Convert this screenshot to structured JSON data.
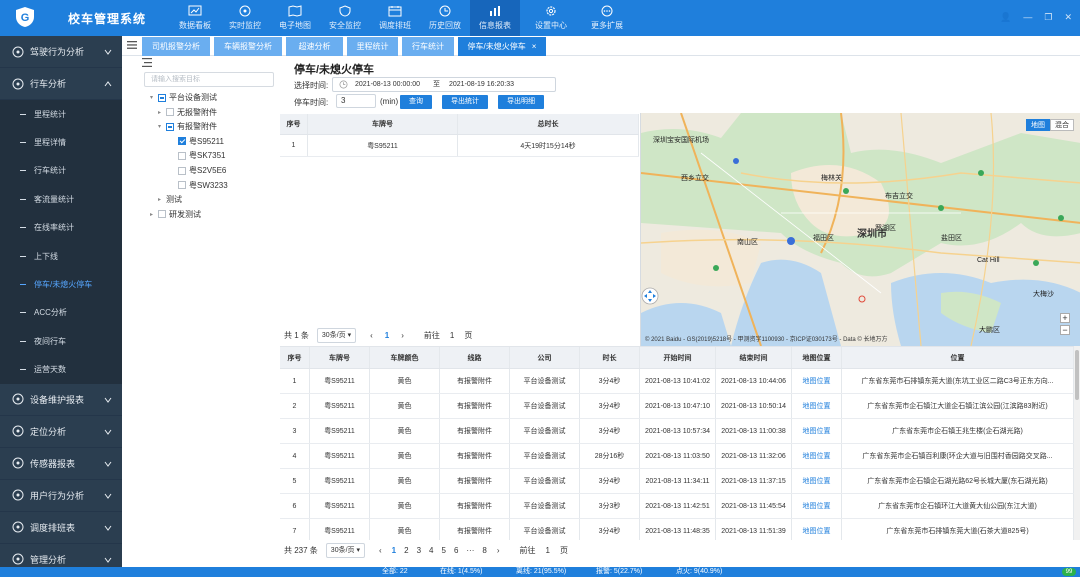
{
  "app": {
    "title": "校车管理系统"
  },
  "topnav": [
    {
      "label": "数据看板",
      "icon": "chart-board-icon"
    },
    {
      "label": "实时监控",
      "icon": "monitor-icon"
    },
    {
      "label": "电子地图",
      "icon": "map-icon"
    },
    {
      "label": "安全监控",
      "icon": "shield-icon"
    },
    {
      "label": "调度排班",
      "icon": "schedule-icon"
    },
    {
      "label": "历史回放",
      "icon": "history-icon"
    },
    {
      "label": "信息报表",
      "icon": "bar-chart-icon",
      "active": true
    },
    {
      "label": "设置中心",
      "icon": "gear-icon"
    },
    {
      "label": "更多扩展",
      "icon": "more-icon"
    }
  ],
  "sidebar": {
    "groups_top": [
      {
        "label": "驾驶行为分析"
      },
      {
        "label": "行车分析"
      }
    ],
    "subitems": [
      {
        "label": "里程统计"
      },
      {
        "label": "里程详情"
      },
      {
        "label": "行车统计"
      },
      {
        "label": "客流量统计"
      },
      {
        "label": "在线率统计"
      },
      {
        "label": "上下线"
      },
      {
        "label": "停车/未熄火停车",
        "active": true
      },
      {
        "label": "ACC分析"
      },
      {
        "label": "夜间行车"
      },
      {
        "label": "运营天数"
      }
    ],
    "groups_bottom": [
      {
        "label": "设备维护报表"
      },
      {
        "label": "定位分析"
      },
      {
        "label": "传感器报表"
      },
      {
        "label": "用户行为分析"
      },
      {
        "label": "调度排班表"
      },
      {
        "label": "管理分析"
      }
    ]
  },
  "tabs": [
    {
      "label": "司机报警分析"
    },
    {
      "label": "车辆报警分析"
    },
    {
      "label": "超速分析"
    },
    {
      "label": "里程统计"
    },
    {
      "label": "行车统计"
    },
    {
      "label": "停车/未熄火停车",
      "active": true,
      "close": "×"
    }
  ],
  "tree": {
    "search_placeholder": "请输入搜索目标",
    "nodes": [
      {
        "label": "平台设备测试",
        "state": "partial",
        "arrow": "▾"
      },
      {
        "label": "无报警附件",
        "state": "none",
        "arrow": "▸"
      },
      {
        "label": "有报警附件",
        "state": "partial",
        "arrow": "▾"
      },
      {
        "label": "粤S95211",
        "state": "checked",
        "arrow": ""
      },
      {
        "label": "粤SK7351",
        "state": "none",
        "arrow": ""
      },
      {
        "label": "粤S2V5E6",
        "state": "none",
        "arrow": ""
      },
      {
        "label": "粤SW3233",
        "state": "none",
        "arrow": ""
      },
      {
        "label": "测试",
        "state": "none-nocb",
        "arrow": "▸"
      },
      {
        "label": "研发测试",
        "state": "none",
        "arrow": "▸"
      }
    ]
  },
  "page": {
    "title": "停车/未熄火停车",
    "time_label": "选择时间:",
    "start": "2021-08-13 00:00:00",
    "to": "至",
    "end": "2021-08-19 16:20:33",
    "stop_label": "停车时间:",
    "stop_value": "3",
    "unit": "(min)",
    "btn_query": "查询",
    "btn_export_stats": "导出统计",
    "btn_export_detail": "导出明细"
  },
  "summary": {
    "headers": [
      "序号",
      "车牌号",
      "总时长"
    ],
    "rows": [
      [
        "1",
        "粤S95211",
        "4天19时15分14秒"
      ]
    ],
    "total": "共 1 条",
    "page_size": "30条/页",
    "page": "1",
    "goto": "前往",
    "goto_value": "1",
    "page_unit": "页",
    "prev": "‹",
    "next": "›"
  },
  "map": {
    "btn_map": "地图",
    "btn_hybrid": "混合",
    "copyright": "© 2021 Baidu - GS(2019)5218号 - 甲测资字1100930 - 京ICP证030173号 - Data © 长地万方",
    "labels": [
      "深圳宝安国际机场",
      "福田区",
      "罗湖区",
      "南山区",
      "深圳市",
      "盐田区",
      "Cat Hill",
      "大鹏区",
      "西乡立交",
      "梅林关",
      "布吉立交",
      "大梅沙"
    ]
  },
  "details": {
    "headers": [
      "序号",
      "车牌号",
      "车牌颜色",
      "线路",
      "公司",
      "时长",
      "开始时间",
      "结束时间",
      "地图位置",
      "位置"
    ],
    "rows": [
      [
        "1",
        "粤S95211",
        "黄色",
        "有报警附件",
        "平台设备测试",
        "3分4秒",
        "2021-08-13 10:41:02",
        "2021-08-13 10:44:06",
        "地图位置",
        "广东省东莞市石排镇东莞大道(东坑工业区二路C3号正东方向..."
      ],
      [
        "2",
        "粤S95211",
        "黄色",
        "有报警附件",
        "平台设备测试",
        "3分4秒",
        "2021-08-13 10:47:10",
        "2021-08-13 10:50:14",
        "地图位置",
        "广东省东莞市企石镇江大道企石镇江滨公园(江滨路83附近)"
      ],
      [
        "3",
        "粤S95211",
        "黄色",
        "有报警附件",
        "平台设备测试",
        "3分4秒",
        "2021-08-13 10:57:34",
        "2021-08-13 11:00:38",
        "地图位置",
        "广东省东莞市企石镇王兆生楼(企石湖光路)"
      ],
      [
        "4",
        "粤S95211",
        "黄色",
        "有报警附件",
        "平台设备测试",
        "28分16秒",
        "2021-08-13 11:03:50",
        "2021-08-13 11:32:06",
        "地图位置",
        "广东省东莞市企石镇百利康(环企大道与旧围村香园路交叉路..."
      ],
      [
        "5",
        "粤S95211",
        "黄色",
        "有报警附件",
        "平台设备测试",
        "3分4秒",
        "2021-08-13 11:34:11",
        "2021-08-13 11:37:15",
        "地图位置",
        "广东省东莞市企石镇企石湖光路62号长城大厦(东石湖光路)"
      ],
      [
        "6",
        "粤S95211",
        "黄色",
        "有报警附件",
        "平台设备测试",
        "3分3秒",
        "2021-08-13 11:42:51",
        "2021-08-13 11:45:54",
        "地图位置",
        "广东省东莞市企石镇环江大道黄大仙公园(东江大道)"
      ],
      [
        "7",
        "粤S95211",
        "黄色",
        "有报警附件",
        "平台设备测试",
        "3分4秒",
        "2021-08-13 11:48:35",
        "2021-08-13 11:51:39",
        "地图位置",
        "广东省东莞市石排镇东莞大道(石茶大道825号)"
      ]
    ],
    "total": "共 237 条",
    "page_size": "30条/页",
    "pages": [
      "1",
      "2",
      "3",
      "4",
      "5",
      "6",
      "···",
      "8"
    ],
    "goto": "前往",
    "goto_value": "1",
    "page_unit": "页",
    "prev": "‹",
    "next": "›"
  },
  "status": {
    "total": "全部: 22",
    "online": "在线: 1(4.5%)",
    "offline": "离线: 21(95.5%)",
    "alarm": "报警: 5(22.7%)",
    "fire": "点火: 9(40.9%)",
    "badge": "99"
  },
  "colors": {
    "primary": "#1f7fdc",
    "sidebar": "#2b3e50",
    "active_text": "#56a6ff"
  }
}
